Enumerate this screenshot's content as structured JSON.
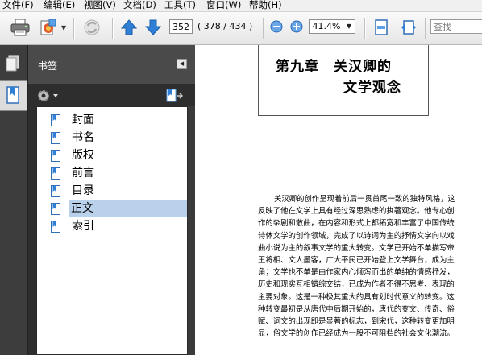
{
  "menubar": {
    "items": [
      "文件(F)",
      "编辑(E)",
      "视图(V)",
      "文档(D)",
      "工具(T)",
      "窗口(W)",
      "帮助(H)"
    ]
  },
  "toolbar": {
    "page_current": "352",
    "page_count": "( 378 / 434 )",
    "zoom": "41.4%",
    "search_placeholder": "查找"
  },
  "icons": {
    "print": "printer-icon",
    "attach": "attach-icon",
    "sync": "sync-icon",
    "prev": "up-arrow-icon",
    "next": "down-arrow-icon",
    "zoom_out": "minus-icon",
    "zoom_in": "plus-icon",
    "fit_page": "fit-page-icon",
    "fit_width": "fit-width-icon"
  },
  "bookmarks_panel": {
    "title": "书签",
    "items": [
      {
        "label": "封面",
        "selected": false
      },
      {
        "label": "书名",
        "selected": false
      },
      {
        "label": "版权",
        "selected": false
      },
      {
        "label": "前言",
        "selected": false
      },
      {
        "label": "目录",
        "selected": false
      },
      {
        "label": "正文",
        "selected": true
      },
      {
        "label": "索引",
        "selected": false
      }
    ]
  },
  "document": {
    "chapter_line1": "第九章　关汉卿的",
    "chapter_line2": "文学观念",
    "lines": [
      "关汉卿的创作呈现着前后一贯首尾一致的独特风格，这",
      "反映了他在文学上具有经过深思熟虑的执著观念。他专心创",
      "作的杂剧和散曲，在内容和形式上都拓宽和丰富了中国传统",
      "诗体文学的创作领域，完成了以诗词为主的抒情文学向以戏",
      "曲小说为主的叙事文学的重大转变。文学已开始不单描写帝",
      "王将相、文人墨客，广大平民已开始登上文学舞台，成为主",
      "角；文学也不单是由作家内心倾泻而出的单纯的情感抒发，",
      "历史和现实互相错综交结，已成为作者不得不思考、表现的",
      "主要对象。这是一种极其重大的具有划时代意义的转变。这",
      "种转变最初是从唐代中后期开始的，唐代的变文、传奇、俗",
      "赋、词文的出现即是显著的标志，到宋代，这种转变更加明",
      "显，俗文学的创作已经成为一股不可阻挡的社会文化潮流。"
    ]
  },
  "colors": {
    "panel_dark": "#2e2e2e",
    "panel_header": "#4a4a4a",
    "selection": "#b9d1ea",
    "arrow_blue": "#2f7fd6"
  }
}
